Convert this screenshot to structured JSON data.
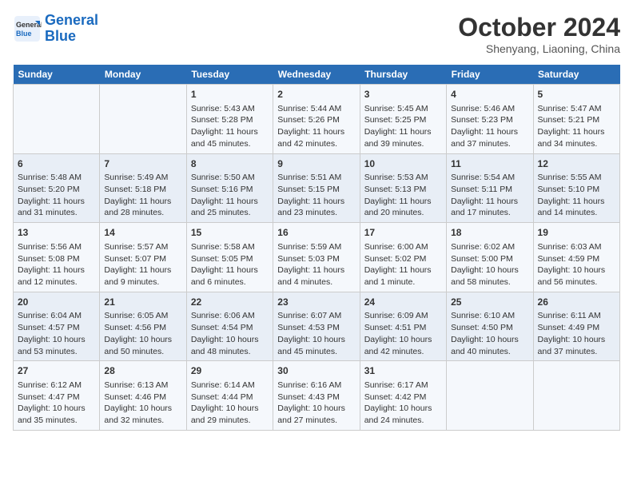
{
  "header": {
    "logo_line1": "General",
    "logo_line2": "Blue",
    "month": "October 2024",
    "location": "Shenyang, Liaoning, China"
  },
  "weekdays": [
    "Sunday",
    "Monday",
    "Tuesday",
    "Wednesday",
    "Thursday",
    "Friday",
    "Saturday"
  ],
  "weeks": [
    [
      {
        "day": "",
        "content": ""
      },
      {
        "day": "",
        "content": ""
      },
      {
        "day": "1",
        "content": "Sunrise: 5:43 AM\nSunset: 5:28 PM\nDaylight: 11 hours and 45 minutes."
      },
      {
        "day": "2",
        "content": "Sunrise: 5:44 AM\nSunset: 5:26 PM\nDaylight: 11 hours and 42 minutes."
      },
      {
        "day": "3",
        "content": "Sunrise: 5:45 AM\nSunset: 5:25 PM\nDaylight: 11 hours and 39 minutes."
      },
      {
        "day": "4",
        "content": "Sunrise: 5:46 AM\nSunset: 5:23 PM\nDaylight: 11 hours and 37 minutes."
      },
      {
        "day": "5",
        "content": "Sunrise: 5:47 AM\nSunset: 5:21 PM\nDaylight: 11 hours and 34 minutes."
      }
    ],
    [
      {
        "day": "6",
        "content": "Sunrise: 5:48 AM\nSunset: 5:20 PM\nDaylight: 11 hours and 31 minutes."
      },
      {
        "day": "7",
        "content": "Sunrise: 5:49 AM\nSunset: 5:18 PM\nDaylight: 11 hours and 28 minutes."
      },
      {
        "day": "8",
        "content": "Sunrise: 5:50 AM\nSunset: 5:16 PM\nDaylight: 11 hours and 25 minutes."
      },
      {
        "day": "9",
        "content": "Sunrise: 5:51 AM\nSunset: 5:15 PM\nDaylight: 11 hours and 23 minutes."
      },
      {
        "day": "10",
        "content": "Sunrise: 5:53 AM\nSunset: 5:13 PM\nDaylight: 11 hours and 20 minutes."
      },
      {
        "day": "11",
        "content": "Sunrise: 5:54 AM\nSunset: 5:11 PM\nDaylight: 11 hours and 17 minutes."
      },
      {
        "day": "12",
        "content": "Sunrise: 5:55 AM\nSunset: 5:10 PM\nDaylight: 11 hours and 14 minutes."
      }
    ],
    [
      {
        "day": "13",
        "content": "Sunrise: 5:56 AM\nSunset: 5:08 PM\nDaylight: 11 hours and 12 minutes."
      },
      {
        "day": "14",
        "content": "Sunrise: 5:57 AM\nSunset: 5:07 PM\nDaylight: 11 hours and 9 minutes."
      },
      {
        "day": "15",
        "content": "Sunrise: 5:58 AM\nSunset: 5:05 PM\nDaylight: 11 hours and 6 minutes."
      },
      {
        "day": "16",
        "content": "Sunrise: 5:59 AM\nSunset: 5:03 PM\nDaylight: 11 hours and 4 minutes."
      },
      {
        "day": "17",
        "content": "Sunrise: 6:00 AM\nSunset: 5:02 PM\nDaylight: 11 hours and 1 minute."
      },
      {
        "day": "18",
        "content": "Sunrise: 6:02 AM\nSunset: 5:00 PM\nDaylight: 10 hours and 58 minutes."
      },
      {
        "day": "19",
        "content": "Sunrise: 6:03 AM\nSunset: 4:59 PM\nDaylight: 10 hours and 56 minutes."
      }
    ],
    [
      {
        "day": "20",
        "content": "Sunrise: 6:04 AM\nSunset: 4:57 PM\nDaylight: 10 hours and 53 minutes."
      },
      {
        "day": "21",
        "content": "Sunrise: 6:05 AM\nSunset: 4:56 PM\nDaylight: 10 hours and 50 minutes."
      },
      {
        "day": "22",
        "content": "Sunrise: 6:06 AM\nSunset: 4:54 PM\nDaylight: 10 hours and 48 minutes."
      },
      {
        "day": "23",
        "content": "Sunrise: 6:07 AM\nSunset: 4:53 PM\nDaylight: 10 hours and 45 minutes."
      },
      {
        "day": "24",
        "content": "Sunrise: 6:09 AM\nSunset: 4:51 PM\nDaylight: 10 hours and 42 minutes."
      },
      {
        "day": "25",
        "content": "Sunrise: 6:10 AM\nSunset: 4:50 PM\nDaylight: 10 hours and 40 minutes."
      },
      {
        "day": "26",
        "content": "Sunrise: 6:11 AM\nSunset: 4:49 PM\nDaylight: 10 hours and 37 minutes."
      }
    ],
    [
      {
        "day": "27",
        "content": "Sunrise: 6:12 AM\nSunset: 4:47 PM\nDaylight: 10 hours and 35 minutes."
      },
      {
        "day": "28",
        "content": "Sunrise: 6:13 AM\nSunset: 4:46 PM\nDaylight: 10 hours and 32 minutes."
      },
      {
        "day": "29",
        "content": "Sunrise: 6:14 AM\nSunset: 4:44 PM\nDaylight: 10 hours and 29 minutes."
      },
      {
        "day": "30",
        "content": "Sunrise: 6:16 AM\nSunset: 4:43 PM\nDaylight: 10 hours and 27 minutes."
      },
      {
        "day": "31",
        "content": "Sunrise: 6:17 AM\nSunset: 4:42 PM\nDaylight: 10 hours and 24 minutes."
      },
      {
        "day": "",
        "content": ""
      },
      {
        "day": "",
        "content": ""
      }
    ]
  ]
}
